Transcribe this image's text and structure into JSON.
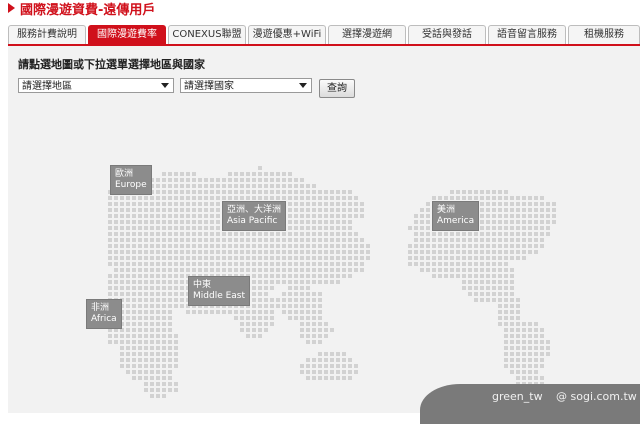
{
  "page": {
    "title": "國際漫遊資費-遠傳用戶"
  },
  "tabs": [
    {
      "label": "服務計費說明",
      "active": false
    },
    {
      "label": "國際漫遊費率",
      "active": true
    },
    {
      "label": "CONEXUS聯盟",
      "active": false
    },
    {
      "label": "漫遊優惠+WiFi",
      "active": false
    },
    {
      "label": "選擇漫遊網",
      "active": false
    },
    {
      "label": "受話與發話",
      "active": false
    },
    {
      "label": "語音留言服務",
      "active": false
    },
    {
      "label": "租機服務",
      "active": false
    }
  ],
  "search": {
    "instruction": "請點選地圖或下拉選單選擇地區與國家",
    "region_select": "請選擇地區",
    "country_select": "請選擇國家",
    "query_button": "查詢"
  },
  "map": {
    "dot_color": "#d2d2d2",
    "label_color": "#8c8c8c",
    "regions": [
      {
        "zh": "歐洲",
        "en": "Europe"
      },
      {
        "zh": "亞洲、大洋洲",
        "en": "Asia Pacific"
      },
      {
        "zh": "美洲",
        "en": "America"
      },
      {
        "zh": "中東",
        "en": "Middle East"
      },
      {
        "zh": "非洲",
        "en": "Africa"
      }
    ]
  },
  "watermark": {
    "left": "green_tw",
    "right": "@ sogi.com.tw"
  }
}
